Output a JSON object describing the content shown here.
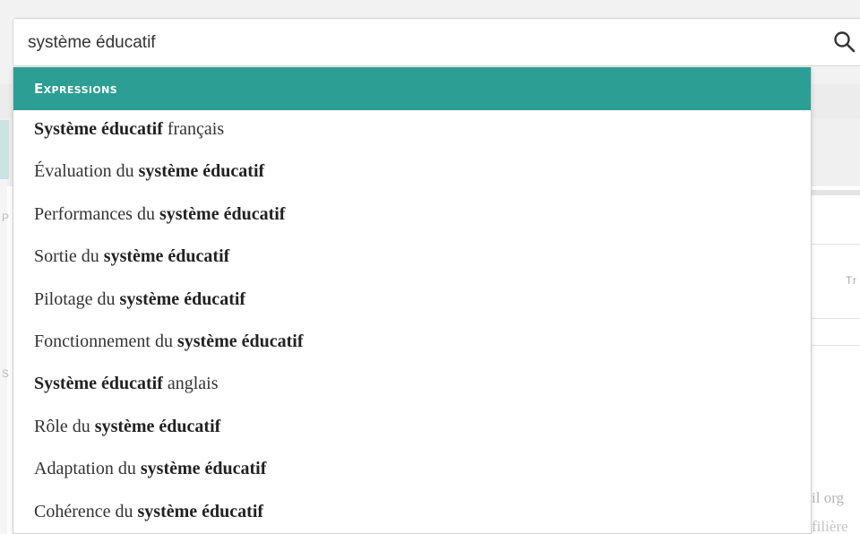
{
  "search": {
    "value": "système éducatif"
  },
  "icons": {
    "search": "search-icon"
  },
  "dropdown": {
    "header": "Expressions",
    "items": [
      {
        "before": "",
        "bold": "Système éducatif",
        "after": " français"
      },
      {
        "before": "Évaluation du ",
        "bold": "système éducatif",
        "after": ""
      },
      {
        "before": "Performances du ",
        "bold": "système éducatif",
        "after": ""
      },
      {
        "before": "Sortie du ",
        "bold": "système éducatif",
        "after": ""
      },
      {
        "before": "Pilotage du ",
        "bold": "système éducatif",
        "after": ""
      },
      {
        "before": "Fonctionnement du ",
        "bold": "système éducatif",
        "after": ""
      },
      {
        "before": "",
        "bold": "Système éducatif",
        "after": " anglais"
      },
      {
        "before": "Rôle du ",
        "bold": "système éducatif",
        "after": ""
      },
      {
        "before": "Adaptation du ",
        "bold": "système éducatif",
        "after": ""
      },
      {
        "before": "Cohérence du ",
        "bold": "système éducatif",
        "after": ""
      }
    ]
  },
  "background": {
    "right_label": "Tr",
    "left_letter_1": "P",
    "left_letter_2": "S",
    "text_line_1": "il org",
    "text_line_2": "filière"
  },
  "colors": {
    "accent": "#2c9e94",
    "text": "#333333",
    "border": "#d6d6d6"
  }
}
